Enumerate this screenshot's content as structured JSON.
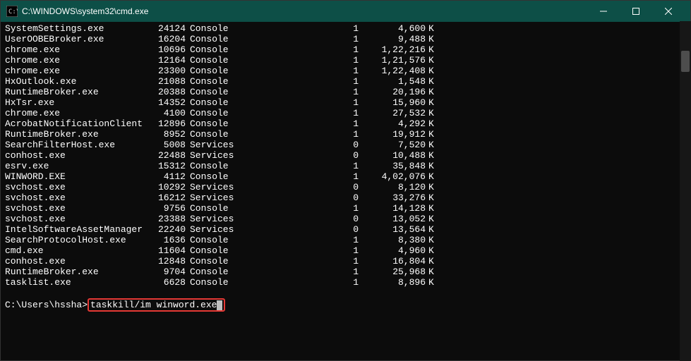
{
  "titlebar": {
    "title": "C:\\WINDOWS\\system32\\cmd.exe"
  },
  "processes": [
    {
      "name": "SystemSettings.exe",
      "pid": "24124",
      "session": "Console",
      "sessnum": "1",
      "mem": "4,600",
      "unit": "K"
    },
    {
      "name": "UserOOBEBroker.exe",
      "pid": "16204",
      "session": "Console",
      "sessnum": "1",
      "mem": "9,488",
      "unit": "K"
    },
    {
      "name": "chrome.exe",
      "pid": "10696",
      "session": "Console",
      "sessnum": "1",
      "mem": "1,22,216",
      "unit": "K"
    },
    {
      "name": "chrome.exe",
      "pid": "12164",
      "session": "Console",
      "sessnum": "1",
      "mem": "1,21,576",
      "unit": "K"
    },
    {
      "name": "chrome.exe",
      "pid": "23300",
      "session": "Console",
      "sessnum": "1",
      "mem": "1,22,408",
      "unit": "K"
    },
    {
      "name": "HxOutlook.exe",
      "pid": "21088",
      "session": "Console",
      "sessnum": "1",
      "mem": "1,548",
      "unit": "K"
    },
    {
      "name": "RuntimeBroker.exe",
      "pid": "20388",
      "session": "Console",
      "sessnum": "1",
      "mem": "20,196",
      "unit": "K"
    },
    {
      "name": "HxTsr.exe",
      "pid": "14352",
      "session": "Console",
      "sessnum": "1",
      "mem": "15,960",
      "unit": "K"
    },
    {
      "name": "chrome.exe",
      "pid": "4100",
      "session": "Console",
      "sessnum": "1",
      "mem": "27,532",
      "unit": "K"
    },
    {
      "name": "AcrobatNotificationClient",
      "pid": "12896",
      "session": "Console",
      "sessnum": "1",
      "mem": "4,292",
      "unit": "K"
    },
    {
      "name": "RuntimeBroker.exe",
      "pid": "8952",
      "session": "Console",
      "sessnum": "1",
      "mem": "19,912",
      "unit": "K"
    },
    {
      "name": "SearchFilterHost.exe",
      "pid": "5008",
      "session": "Services",
      "sessnum": "0",
      "mem": "7,520",
      "unit": "K"
    },
    {
      "name": "conhost.exe",
      "pid": "22488",
      "session": "Services",
      "sessnum": "0",
      "mem": "10,488",
      "unit": "K"
    },
    {
      "name": "esrv.exe",
      "pid": "15312",
      "session": "Console",
      "sessnum": "1",
      "mem": "35,848",
      "unit": "K"
    },
    {
      "name": "WINWORD.EXE",
      "pid": "4112",
      "session": "Console",
      "sessnum": "1",
      "mem": "4,02,076",
      "unit": "K"
    },
    {
      "name": "svchost.exe",
      "pid": "10292",
      "session": "Services",
      "sessnum": "0",
      "mem": "8,120",
      "unit": "K"
    },
    {
      "name": "svchost.exe",
      "pid": "16212",
      "session": "Services",
      "sessnum": "0",
      "mem": "33,276",
      "unit": "K"
    },
    {
      "name": "svchost.exe",
      "pid": "9756",
      "session": "Console",
      "sessnum": "1",
      "mem": "14,128",
      "unit": "K"
    },
    {
      "name": "svchost.exe",
      "pid": "23388",
      "session": "Services",
      "sessnum": "0",
      "mem": "13,052",
      "unit": "K"
    },
    {
      "name": "IntelSoftwareAssetManager",
      "pid": "22240",
      "session": "Services",
      "sessnum": "0",
      "mem": "13,564",
      "unit": "K"
    },
    {
      "name": "SearchProtocolHost.exe",
      "pid": "1636",
      "session": "Console",
      "sessnum": "1",
      "mem": "8,380",
      "unit": "K"
    },
    {
      "name": "cmd.exe",
      "pid": "11604",
      "session": "Console",
      "sessnum": "1",
      "mem": "4,960",
      "unit": "K"
    },
    {
      "name": "conhost.exe",
      "pid": "12848",
      "session": "Console",
      "sessnum": "1",
      "mem": "16,804",
      "unit": "K"
    },
    {
      "name": "RuntimeBroker.exe",
      "pid": "9704",
      "session": "Console",
      "sessnum": "1",
      "mem": "25,968",
      "unit": "K"
    },
    {
      "name": "tasklist.exe",
      "pid": "6628",
      "session": "Console",
      "sessnum": "1",
      "mem": "8,896",
      "unit": "K"
    }
  ],
  "prompt": {
    "path": "C:\\Users\\hssha>",
    "command": "taskkill/im winword.exe"
  }
}
